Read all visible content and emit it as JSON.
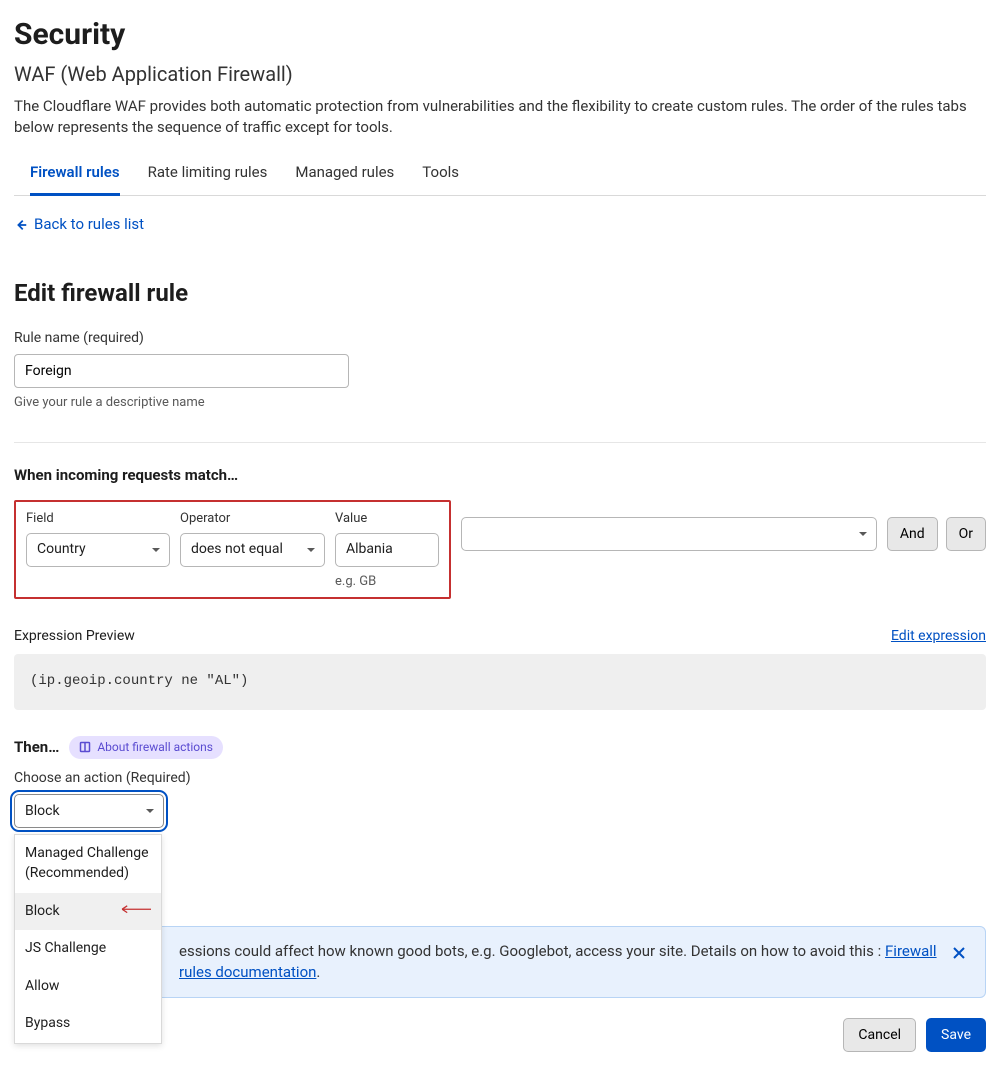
{
  "page": {
    "title": "Security",
    "subtitle": "WAF (Web Application Firewall)",
    "description": "The Cloudflare WAF provides both automatic protection from vulnerabilities and the flexibility to create custom rules. The order of the rules tabs below represents the sequence of traffic except for tools."
  },
  "tabs": {
    "t0": "Firewall rules",
    "t1": "Rate limiting rules",
    "t2": "Managed rules",
    "t3": "Tools"
  },
  "back_link": "Back to rules list",
  "edit_heading": "Edit firewall rule",
  "rule_name": {
    "label": "Rule name (required)",
    "value": "Foreign",
    "help": "Give your rule a descriptive name"
  },
  "match_section": "When incoming requests match…",
  "rule_builder": {
    "field_label": "Field",
    "operator_label": "Operator",
    "value_label": "Value",
    "field_value": "Country",
    "operator_value": "does not equal",
    "value_value": "Albania",
    "example": "e.g. GB",
    "and": "And",
    "or": "Or"
  },
  "expression": {
    "label": "Expression Preview",
    "edit_link": "Edit expression",
    "code": "(ip.geoip.country ne \"AL\")"
  },
  "then": {
    "heading": "Then…",
    "badge": "About firewall actions",
    "choose_label": "Choose an action (Required)",
    "selected": "Block",
    "options": {
      "o0": "Managed Challenge (Recommended)",
      "o1": "Block",
      "o2": "JS Challenge",
      "o3": "Allow",
      "o4": "Bypass"
    }
  },
  "banner": {
    "text_partial": "essions could affect how known good bots, e.g. Googlebot, access your site. Details on how to avoid this ",
    "link": "Firewall rules documentation",
    "period": "."
  },
  "footer": {
    "cancel": "Cancel",
    "save": "Save"
  }
}
